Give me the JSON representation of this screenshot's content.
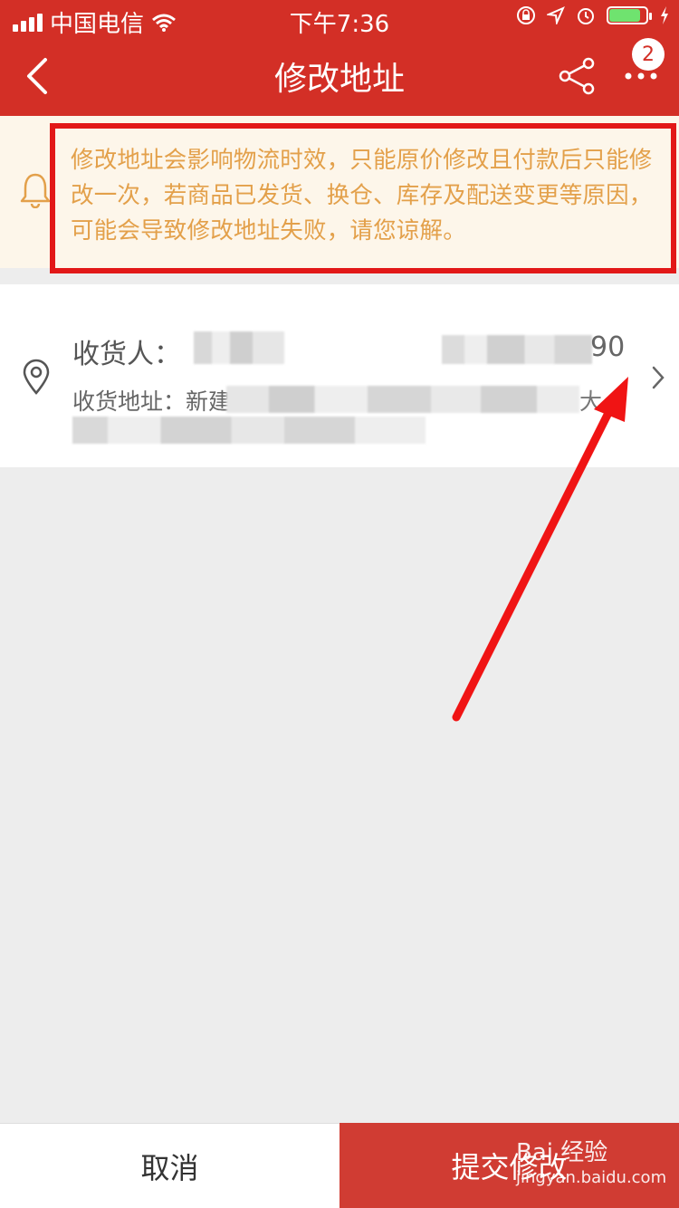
{
  "status": {
    "carrier": "中国电信",
    "time": "下午7:36"
  },
  "nav": {
    "title": "修改地址",
    "badge": "2"
  },
  "notice": {
    "text": "修改地址会影响物流时效，只能原价修改且付款后只能修改一次，若商品已发货、换仓、库存及配送变更等原因，可能会导致修改地址失败，请您谅解。"
  },
  "address": {
    "receiver_label": "收货人：",
    "phone_tail": "90",
    "address_label": "收货地址：新建",
    "address_tail": "大"
  },
  "bottom": {
    "cancel": "取消",
    "submit": "提交修改"
  },
  "watermark": {
    "brand": "Bai 经验",
    "url": "jingyan.baidu.com"
  },
  "colors": {
    "brand_red": "#d32f26",
    "notice_bg": "#fdf6ea",
    "notice_text": "#e3a04a",
    "annotation_red": "#e21818"
  },
  "icons": [
    "back-arrow-icon",
    "share-icon",
    "more-icon",
    "bell-icon",
    "location-pin-icon",
    "chevron-right-icon",
    "wifi-icon",
    "battery-icon"
  ]
}
